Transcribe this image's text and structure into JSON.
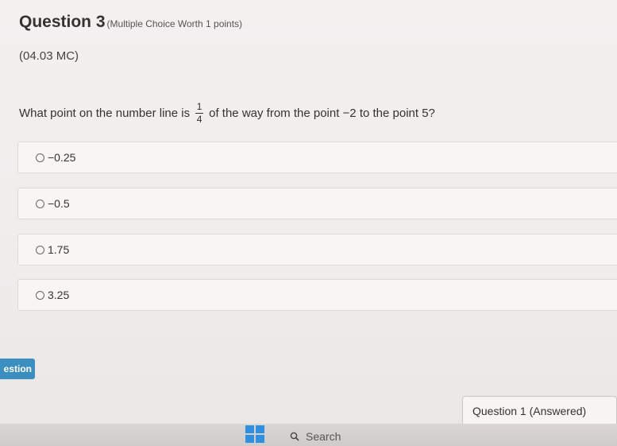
{
  "question": {
    "title": "Question 3",
    "type": "(Multiple Choice Worth 1 points)",
    "code": "(04.03 MC)",
    "prompt_before": "What point on the number line is",
    "fraction_num": "1",
    "fraction_den": "4",
    "prompt_after": "of the way from the point −2 to the point 5?"
  },
  "choices": [
    {
      "label": "−0.25"
    },
    {
      "label": "−0.5"
    },
    {
      "label": "1.75"
    },
    {
      "label": "3.25"
    }
  ],
  "nav": {
    "question_tab_label": "estion",
    "answered_label": "Question 1 (Answered)"
  },
  "taskbar": {
    "search_label": "Search"
  },
  "colors": {
    "accent": "#3a8fc0"
  }
}
